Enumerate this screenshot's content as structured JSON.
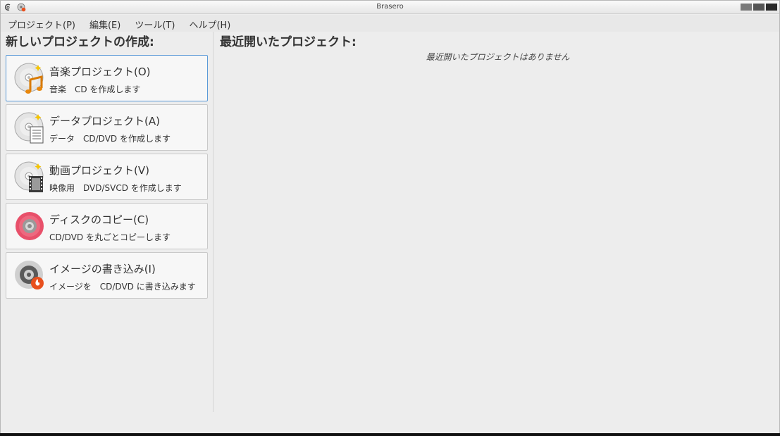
{
  "window": {
    "title": "Brasero"
  },
  "menu": [
    {
      "label": "プロジェクト(P)"
    },
    {
      "label": "編集(E)"
    },
    {
      "label": "ツール(T)"
    },
    {
      "label": "ヘルプ(H)"
    }
  ],
  "left": {
    "heading": "新しいプロジェクトの作成:",
    "projects": [
      {
        "title": "音楽プロジェクト(O)",
        "desc": "音楽　CD を作成します",
        "icon": "music-disc-icon"
      },
      {
        "title": "データプロジェクト(A)",
        "desc": "データ　CD/DVD を作成します",
        "icon": "data-disc-icon"
      },
      {
        "title": "動画プロジェクト(V)",
        "desc": "映像用　DVD/SVCD を作成します",
        "icon": "video-disc-icon"
      },
      {
        "title": "ディスクのコピー(C)",
        "desc": "CD/DVD を丸ごとコピーします",
        "icon": "disc-copy-icon"
      },
      {
        "title": "イメージの書き込み(I)",
        "desc": "イメージを　CD/DVD に書き込みます",
        "icon": "burn-image-icon"
      }
    ]
  },
  "right": {
    "heading": "最近開いたプロジェクト:",
    "empty_text": "最近開いたプロジェクトはありません"
  },
  "colors": {
    "focus_border": "#5b9ad8",
    "copy_disc": "#e8506a",
    "burn_badge": "#e8501e"
  }
}
